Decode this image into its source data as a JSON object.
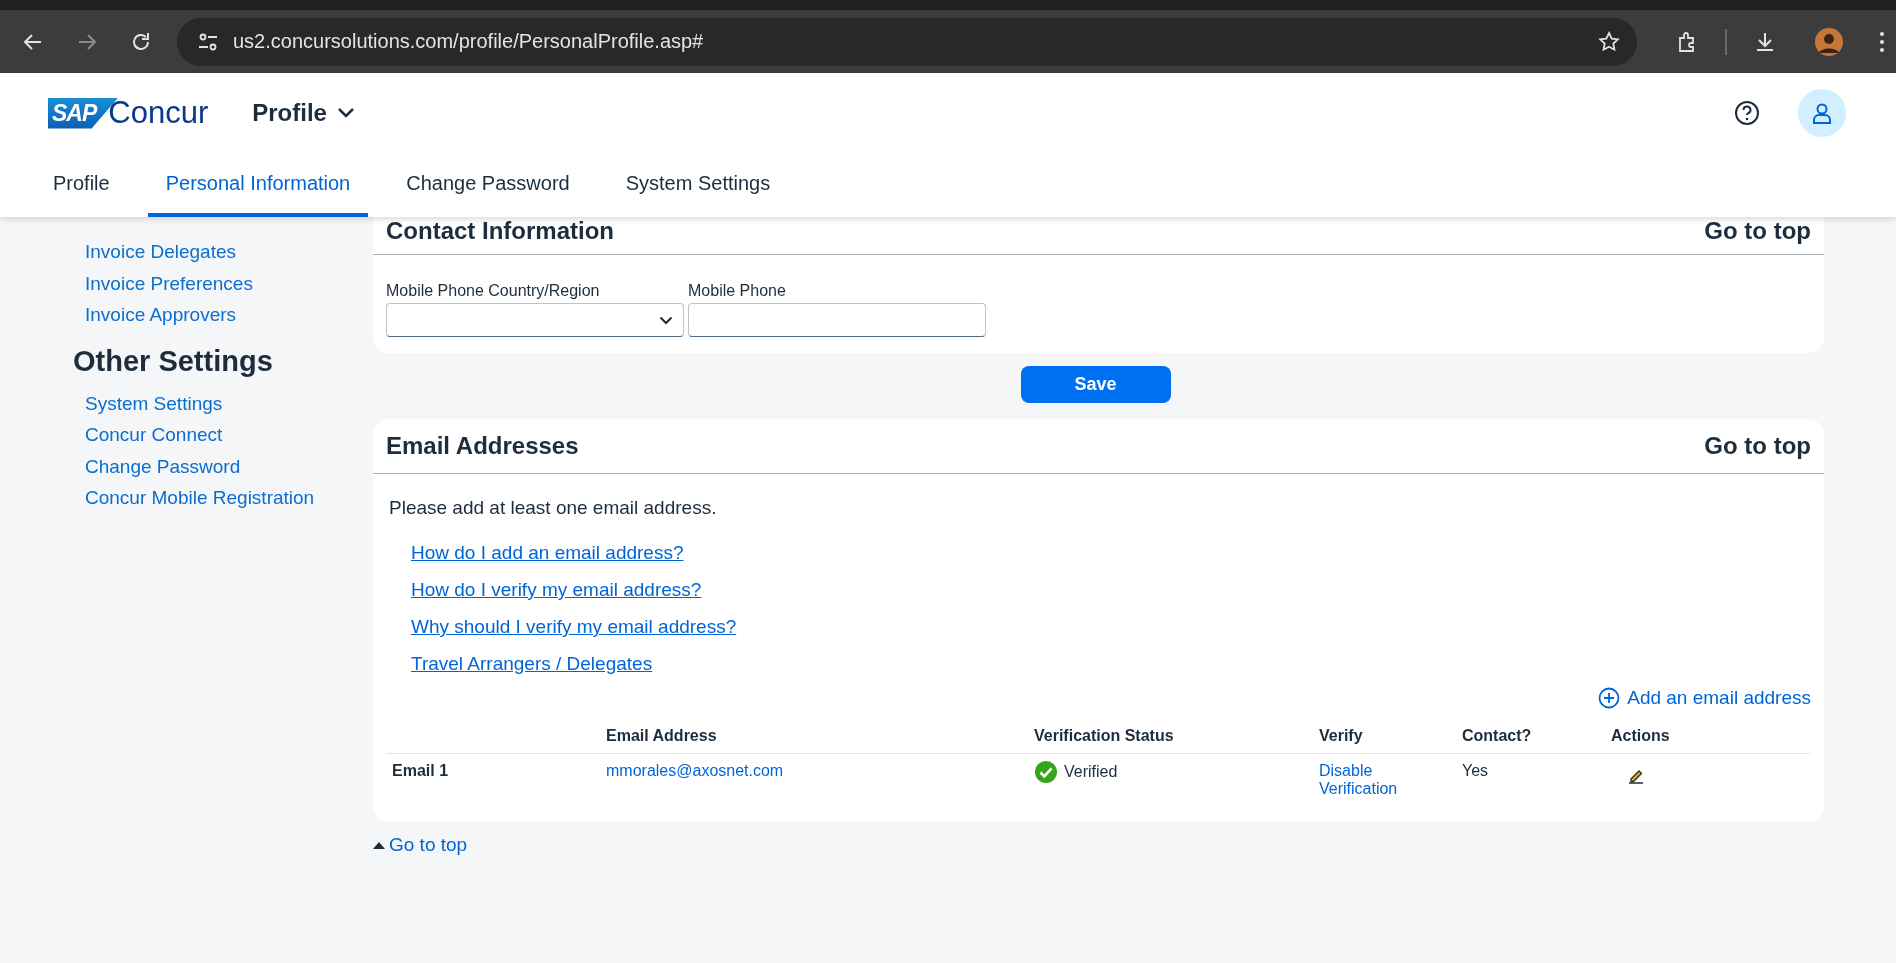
{
  "browser": {
    "nav_buttons": [
      {
        "kind": "back",
        "disabled": false
      },
      {
        "kind": "forward",
        "disabled": true
      },
      {
        "kind": "reload",
        "disabled": false
      }
    ],
    "url": "us2.concursolutions.com/profile/PersonalProfile.asp#"
  },
  "app_header": {
    "brand": {
      "mark": "SAP",
      "name": "Concur"
    },
    "module_menu": "Profile"
  },
  "tabs": [
    {
      "label": "Profile",
      "selected": false
    },
    {
      "label": "Personal Information",
      "selected": true
    },
    {
      "label": "Change Password",
      "selected": false
    },
    {
      "label": "System Settings",
      "selected": false
    }
  ],
  "sidebar": {
    "groups": [
      {
        "items": [
          "Invoice Delegates",
          "Invoice Preferences",
          "Invoice Approvers"
        ]
      },
      {
        "heading": "Other Settings",
        "items": [
          "System Settings",
          "Concur Connect",
          "Change Password",
          "Concur Mobile Registration"
        ]
      }
    ]
  },
  "contact_section": {
    "title": "Contact Information",
    "go_to_top": "Go to top",
    "fields": [
      {
        "kind": "select",
        "label": "Mobile Phone Country/Region"
      },
      {
        "kind": "text",
        "label": "Mobile Phone"
      }
    ]
  },
  "save_button": "Save",
  "email_section": {
    "title": "Email Addresses",
    "go_to_top": "Go to top",
    "intro": "Please add at least one email address.",
    "help_links": [
      "How do I add an email address?",
      "How do I verify my email address?",
      "Why should I verify my email address?",
      "Travel Arrangers / Delegates"
    ],
    "add_link": "Add an email address",
    "table": {
      "columns": [
        "Email Address",
        "Verification Status",
        "Verify",
        "Contact?",
        "Actions"
      ],
      "rows": [
        {
          "label": "Email 1",
          "email": "mmorales@axosnet.com",
          "verified": true,
          "status": "Verified",
          "verify_action": "Disable Verification",
          "contact": "Yes"
        }
      ]
    }
  },
  "footer_link": "Go to top"
}
